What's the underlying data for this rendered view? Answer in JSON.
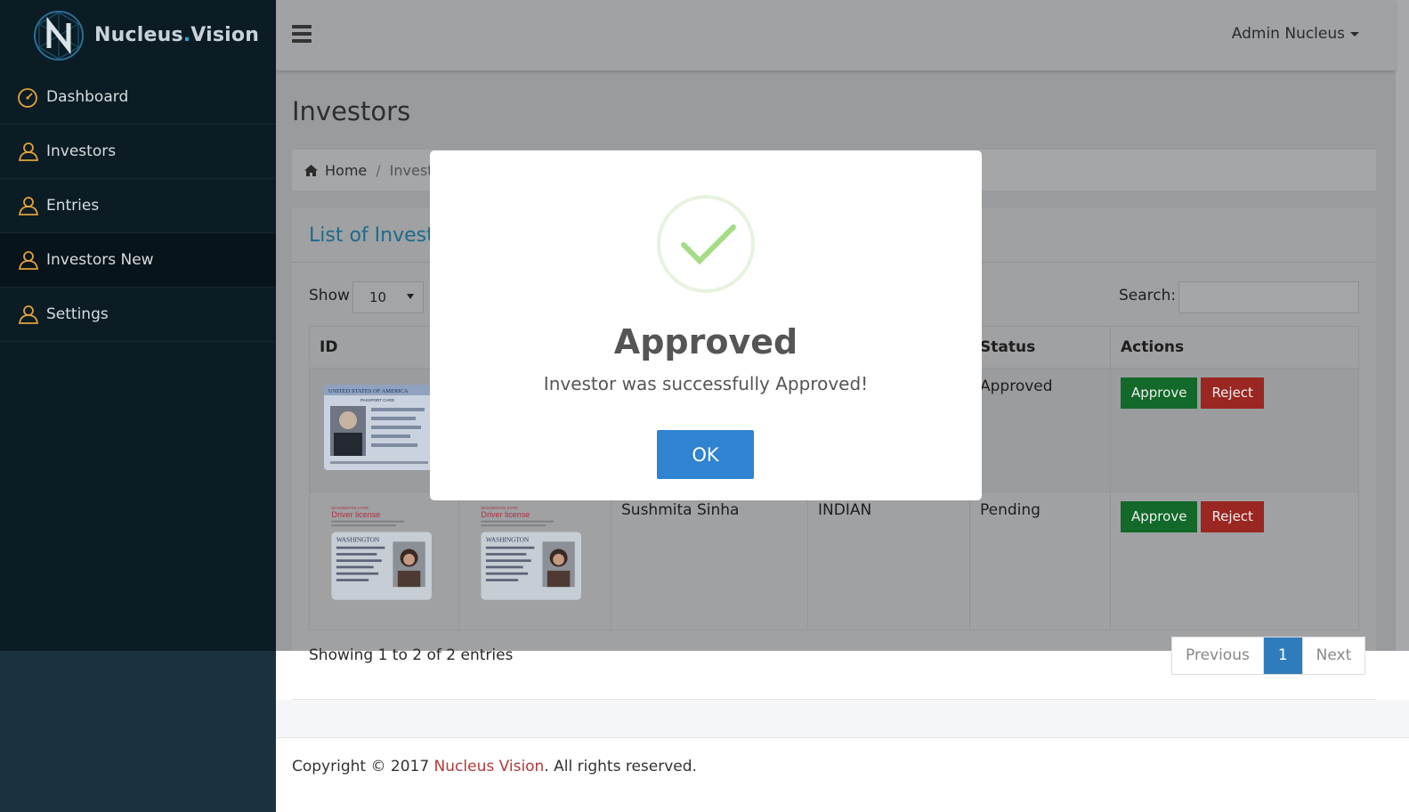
{
  "brand": {
    "name_main": "Nucleus",
    "name_dot": ".",
    "name_tail": "Vision"
  },
  "sidebar": {
    "items": [
      {
        "label": "Dashboard",
        "icon": "speedometer-icon"
      },
      {
        "label": "Investors",
        "icon": "user-icon"
      },
      {
        "label": "Entries",
        "icon": "user-icon"
      },
      {
        "label": "Investors New",
        "icon": "user-icon",
        "active": true
      },
      {
        "label": "Settings",
        "icon": "user-icon"
      }
    ]
  },
  "header": {
    "user_name": "Admin Nucleus"
  },
  "page": {
    "title": "Investors",
    "breadcrumb": {
      "home": "Home",
      "current": "Investo"
    }
  },
  "panel": {
    "title": "List of Investo",
    "show_label": "Show",
    "show_value": "10",
    "search_label": "Search:",
    "search_value": ""
  },
  "table": {
    "headers": {
      "id": "ID",
      "status": "Status",
      "actions": "Actions"
    },
    "rows": [
      {
        "name": "",
        "nationality": "",
        "status": "Approved",
        "approve_label": "Approve",
        "reject_label": "Reject"
      },
      {
        "name": "Sushmita Sinha",
        "nationality": "INDIAN",
        "status": "Pending",
        "approve_label": "Approve",
        "reject_label": "Reject"
      }
    ],
    "doc_labels": {
      "passport": "UNITED STATES OF AMERICA",
      "passport_card": "PASSPORT CARD",
      "state": "WASHINGTON STATE",
      "license": "Driver license",
      "wa": "WASHINGTON"
    }
  },
  "table_info": "Showing 1 to 2 of 2 entries",
  "pagination": {
    "previous": "Previous",
    "current": "1",
    "next": "Next"
  },
  "footer": {
    "prefix": "Copyright © 2017 ",
    "brand": "Nucleus Vision",
    "suffix": ". All rights reserved."
  },
  "modal": {
    "title": "Approved",
    "message": "Investor was successfully Approved!",
    "ok_label": "OK",
    "icon": "checkmark-icon"
  },
  "colors": {
    "sidebar_bg": "#0b1c24",
    "accent_blue": "#3083d0",
    "approve_green": "#12692a",
    "reject_red": "#9b2722",
    "success_check": "#a5dc86"
  }
}
